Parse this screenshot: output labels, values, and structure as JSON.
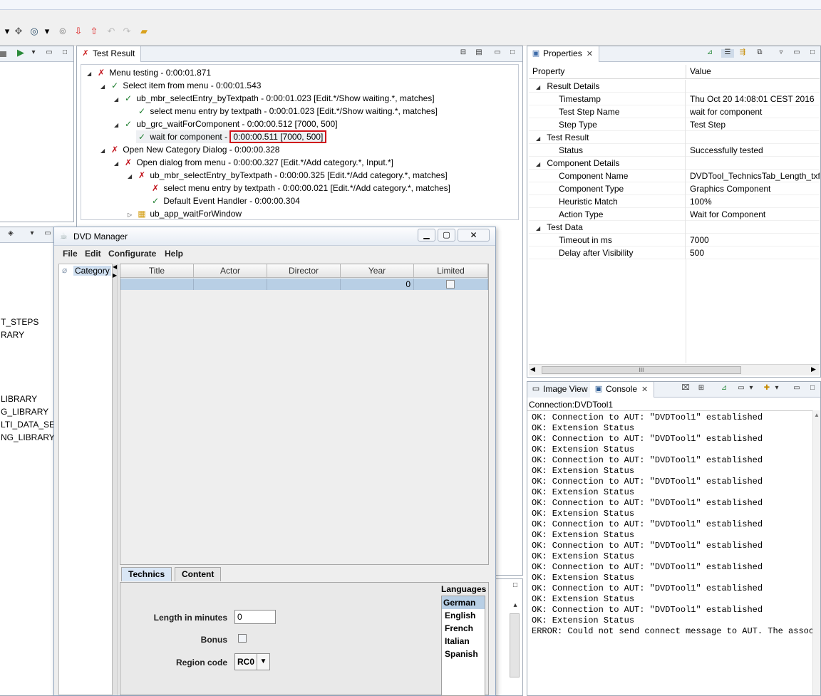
{
  "toolbar": {
    "icons": [
      "pointer-dropdown-icon",
      "spy-dropdown-icon",
      "target-dropdown-icon",
      "record-icon",
      "down-arrow-icon",
      "up-arrow-icon",
      "undo-icon",
      "redo-icon",
      "folder-icon"
    ]
  },
  "left_panel": {
    "items": [
      "T_STEPS",
      "RARY",
      "LIBRARY",
      "G_LIBRARY",
      "LTI_DATA_SET",
      "NG_LIBRARY"
    ]
  },
  "test_result": {
    "tab_label": "Test Result",
    "tree": [
      {
        "status": "fail",
        "text": "Menu testing - 0:00:01.871"
      },
      {
        "status": "pass",
        "text": "Select item from menu - 0:00:01.543"
      },
      {
        "status": "pass",
        "text": "ub_mbr_selectEntry_byTextpath - 0:00:01.023 [Edit.*/Show waiting.*, matches]"
      },
      {
        "status": "pass",
        "text": "select menu entry by textpath - 0:00:01.023 [Edit.*/Show waiting.*, matches]"
      },
      {
        "status": "pass",
        "text": "ub_grc_waitForComponent - 0:00:00.512 [7000, 500]"
      },
      {
        "status": "pass",
        "text": "wait for component - ",
        "highlight": "0:00:00.511 [7000, 500]"
      },
      {
        "status": "fail",
        "text": "Open New Category Dialog - 0:00:00.328"
      },
      {
        "status": "fail",
        "text": "Open dialog from menu - 0:00:00.327 [Edit.*/Add category.*, Input.*]"
      },
      {
        "status": "fail",
        "text": "ub_mbr_selectEntry_byTextpath - 0:00:00.325 [Edit.*/Add category.*, matches]"
      },
      {
        "status": "fail",
        "text": "select menu entry by textpath - 0:00:00.021 [Edit.*/Add category.*, matches]"
      },
      {
        "status": "pass",
        "text": "Default Event Handler - 0:00:00.304"
      },
      {
        "status": "none",
        "text": "ub_app_waitForWindow"
      }
    ]
  },
  "properties": {
    "tab_label": "Properties",
    "col_property": "Property",
    "col_value": "Value",
    "rows": [
      {
        "key": "Result Details",
        "value": "",
        "group": true
      },
      {
        "key": "Timestamp",
        "value": "Thu Oct 20 14:08:01 CEST 2016",
        "group": false
      },
      {
        "key": "Test Step Name",
        "value": "wait for component",
        "group": false
      },
      {
        "key": "Step Type",
        "value": "Test Step",
        "group": false
      },
      {
        "key": "Test Result",
        "value": "",
        "group": true
      },
      {
        "key": "Status",
        "value": "Successfully tested",
        "group": false
      },
      {
        "key": "Component Details",
        "value": "",
        "group": true
      },
      {
        "key": "Component Name",
        "value": "DVDTool_TechnicsTab_Length_txf",
        "group": false
      },
      {
        "key": "Component Type",
        "value": "Graphics Component",
        "group": false
      },
      {
        "key": "Heuristic Match",
        "value": "100%",
        "group": false
      },
      {
        "key": "Action Type",
        "value": "Wait for Component",
        "group": false
      },
      {
        "key": "Test Data",
        "value": "",
        "group": true
      },
      {
        "key": "Timeout in ms",
        "value": "7000",
        "group": false
      },
      {
        "key": "Delay after Visibility",
        "value": "500",
        "group": false
      }
    ],
    "scrollbar_grip": "III"
  },
  "console": {
    "tab_image_view": "Image View",
    "tab_console": "Console",
    "connection": "Connection:DVDTool1",
    "lines": [
      "OK: Connection to AUT: \"DVDTool1\" established",
      "OK: Extension Status",
      "OK: Connection to AUT: \"DVDTool1\" established",
      "OK: Extension Status",
      "OK: Connection to AUT: \"DVDTool1\" established",
      "OK: Extension Status",
      "OK: Connection to AUT: \"DVDTool1\" established",
      "OK: Extension Status",
      "OK: Connection to AUT: \"DVDTool1\" established",
      "OK: Extension Status",
      "OK: Connection to AUT: \"DVDTool1\" established",
      "OK: Extension Status",
      "OK: Connection to AUT: \"DVDTool1\" established",
      "OK: Extension Status",
      "OK: Connection to AUT: \"DVDTool1\" established",
      "OK: Extension Status",
      "OK: Connection to AUT: \"DVDTool1\" established",
      "OK: Extension Status",
      "OK: Connection to AUT: \"DVDTool1\" established",
      "OK: Extension Status",
      "ERROR: Could not send connect message to AUT. The associ"
    ]
  },
  "dvd": {
    "title": "DVD Manager",
    "menu": [
      "File",
      "Edit",
      "Configurate",
      "Help"
    ],
    "category": "Category",
    "columns": [
      "Title",
      "Actor",
      "Director",
      "Year",
      "Limited"
    ],
    "row": {
      "title": "",
      "actor": "",
      "director": "",
      "year": "0",
      "limited": false
    },
    "tabs": [
      "Technics",
      "Content"
    ],
    "length_label": "Length in minutes",
    "length_value": "0",
    "bonus_label": "Bonus",
    "region_label": "Region code",
    "region_value": "RC0",
    "languages_label": "Languages",
    "languages": [
      "German",
      "English",
      "French",
      "Italian",
      "Spanish"
    ],
    "selected_language": "German",
    "window_buttons": [
      "minimize",
      "maximize",
      "close"
    ]
  }
}
